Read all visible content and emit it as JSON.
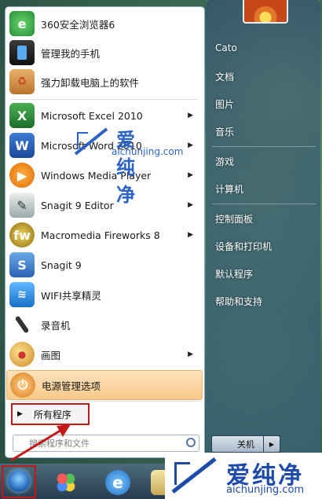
{
  "left_menu": {
    "items": [
      {
        "label": "360安全浏览器6",
        "icon": "browser-360-icon",
        "has_arrow": false
      },
      {
        "label": "管理我的手机",
        "icon": "phone-manager-icon",
        "has_arrow": false
      },
      {
        "label": "强力卸载电脑上的软件",
        "icon": "uninstall-box-icon",
        "has_arrow": false
      },
      {
        "label": "Microsoft Excel 2010",
        "icon": "excel-icon",
        "has_arrow": true
      },
      {
        "label": "Microsoft Word 2010",
        "icon": "word-icon",
        "has_arrow": true
      },
      {
        "label": "Windows Media Player",
        "icon": "media-player-icon",
        "has_arrow": true
      },
      {
        "label": "Snagit 9 Editor",
        "icon": "snagit-editor-icon",
        "has_arrow": true
      },
      {
        "label": "Macromedia Fireworks 8",
        "icon": "fireworks-icon",
        "has_arrow": true
      },
      {
        "label": "Snagit 9",
        "icon": "snagit-icon",
        "has_arrow": false
      },
      {
        "label": "WIFI共享精灵",
        "icon": "wifi-icon",
        "has_arrow": false
      },
      {
        "label": "录音机",
        "icon": "microphone-icon",
        "has_arrow": false
      },
      {
        "label": "画图",
        "icon": "paint-icon",
        "has_arrow": true
      },
      {
        "label": "电源管理选项",
        "icon": "power-options-icon",
        "has_arrow": false
      }
    ],
    "all_programs": "所有程序",
    "search_placeholder": "搜索程序和文件"
  },
  "right_menu": {
    "items": [
      "Cato",
      "文档",
      "图片",
      "音乐",
      "游戏",
      "计算机",
      "控制面板",
      "设备和打印机",
      "默认程序",
      "帮助和支持"
    ],
    "shutdown_label": "关机"
  },
  "watermarks": {
    "brand": "爱纯净",
    "domain": "aichunjing.com"
  },
  "arrow_glyph": "▶",
  "colors": {
    "highlight_box": "#c21a1a",
    "watermark": "#2b63c6",
    "power_highlight": "#f8c98a"
  }
}
